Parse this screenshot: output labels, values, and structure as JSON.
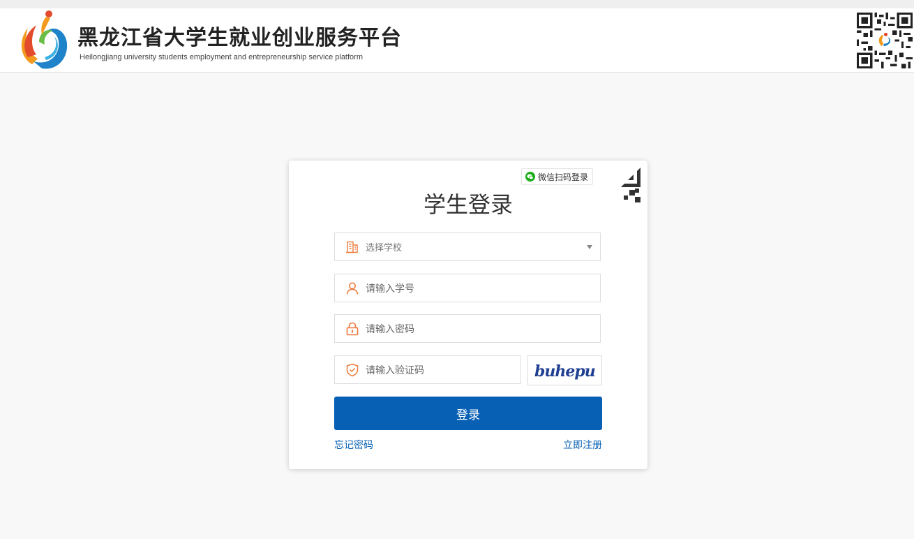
{
  "header": {
    "title_cn": "黑龙江省大学生就业创业服务平台",
    "title_en": "Heilongjiang university students employment and entrepreneurship service platform"
  },
  "login": {
    "wechat_label": "微信扫码登录",
    "title": "学生登录",
    "school_select": {
      "selected": "选择学校"
    },
    "student_id_placeholder": "请输入学号",
    "password_placeholder": "请输入密码",
    "captcha_placeholder": "请输入验证码",
    "captcha_text": "buhepu",
    "submit_label": "登录",
    "forgot_label": "忘记密码",
    "register_label": "立即注册"
  },
  "colors": {
    "primary": "#0860b4",
    "icon_orange": "#ee7a3c",
    "wechat_green": "#1aad19"
  }
}
